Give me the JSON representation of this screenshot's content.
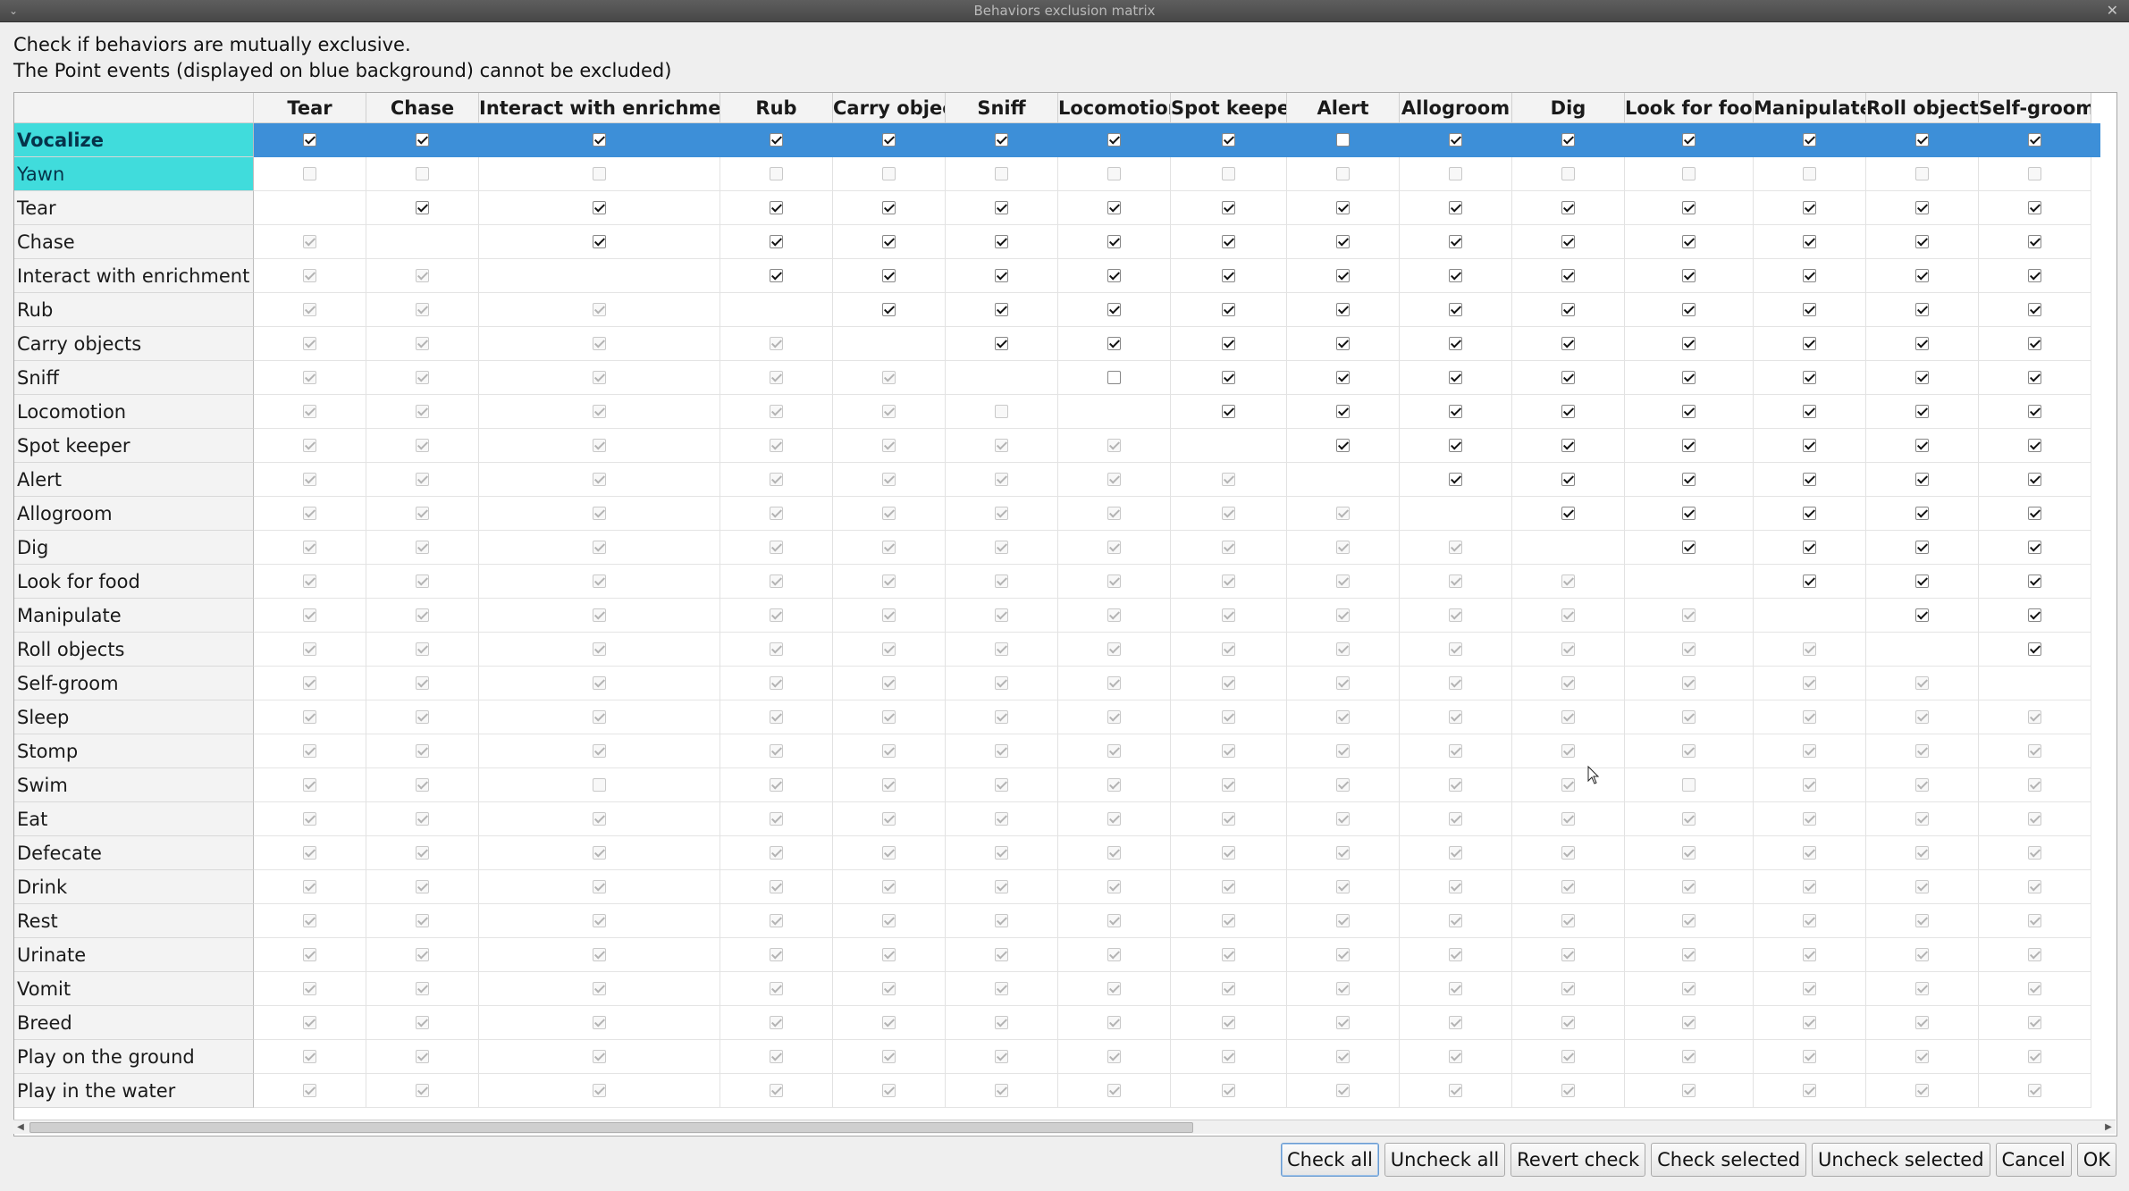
{
  "window": {
    "title": "Behaviors exclusion matrix",
    "menu_glyph": "⌄",
    "close_glyph": "✕"
  },
  "instructions": [
    "Check if behaviors are mutually exclusive.",
    "The Point events (displayed on blue background) cannot be excluded)"
  ],
  "colors": {
    "point_event_bg": "#40dcdc",
    "selected_row_bg": "#3d8fd8"
  },
  "columns": [
    "Tear",
    "Chase",
    "Interact with enrichment",
    "Rub",
    "Carry objects",
    "Sniff",
    "Locomotion",
    "Spot keeper",
    "Alert",
    "Allogroom",
    "Dig",
    "Look for food",
    "Manipulate",
    "Roll objects",
    "Self-groom"
  ],
  "point_events": [
    "Vocalize",
    "Yawn"
  ],
  "selected_row": "Vocalize",
  "rows": [
    "Vocalize",
    "Yawn",
    "Tear",
    "Chase",
    "Interact with enrichment",
    "Rub",
    "Carry objects",
    "Sniff",
    "Locomotion",
    "Spot keeper",
    "Alert",
    "Allogroom",
    "Dig",
    "Look for food",
    "Manipulate",
    "Roll objects",
    "Self-groom",
    "Sleep",
    "Stomp",
    "Swim",
    "Eat",
    "Defecate",
    "Drink",
    "Rest",
    "Urinate",
    "Vomit",
    "Breed",
    "Play on the ground",
    "Play in the water"
  ],
  "matrix_legend": {
    "E": "enabled checked",
    "e": "enabled unchecked",
    "D": "disabled checked",
    "d": "disabled unchecked",
    "-": "empty"
  },
  "matrix": [
    "EEEEEEEEeEEEEEE",
    "ddddddddddddddd",
    "-EEEEEEEEEEEEEE",
    "D-EEEEEEEEEEEEE",
    "DD-EEEEEEEEEEEE",
    "DDD-EEEEEEEEEEE",
    "DDDD-EEEEEEEEEE",
    "DDDDD-eEEEEEEEE",
    "DDDDDd-EEEEEEEE",
    "DDDDDDD-EEEEEEE",
    "DDDDDDDD-EEEEEE",
    "DDDDDDDDD-EEEEE",
    "DDDDDDDDDD-EEEE",
    "DDDDDDDDDDD-EEE",
    "DDDDDDDDDDDD-EE",
    "DDDDDDDDDDDDD-E",
    "DDDDDDDDDDDDDD-",
    "DDDDDDDDDDDDDDD",
    "DDDDDDDDDDDDDDD",
    "DDdDDDDDDDDdDDD",
    "DDDDDDDDDDDDDDD",
    "DDDDDDDDDDDDDDD",
    "DDDDDDDDDDDDDDD",
    "DDDDDDDDDDDDDDD",
    "DDDDDDDDDDDDDDD",
    "DDDDDDDDDDDDDDD",
    "DDDDDDDDDDDDDDD",
    "DDDDDDDDDDDDDDD",
    "DDDDDDDDDDDDDDD"
  ],
  "buttons": {
    "check_all": "Check all",
    "uncheck_all": "Uncheck all",
    "revert_check": "Revert check",
    "check_selected": "Check selected",
    "uncheck_selected": "Uncheck selected",
    "cancel": "Cancel",
    "ok": "OK"
  }
}
